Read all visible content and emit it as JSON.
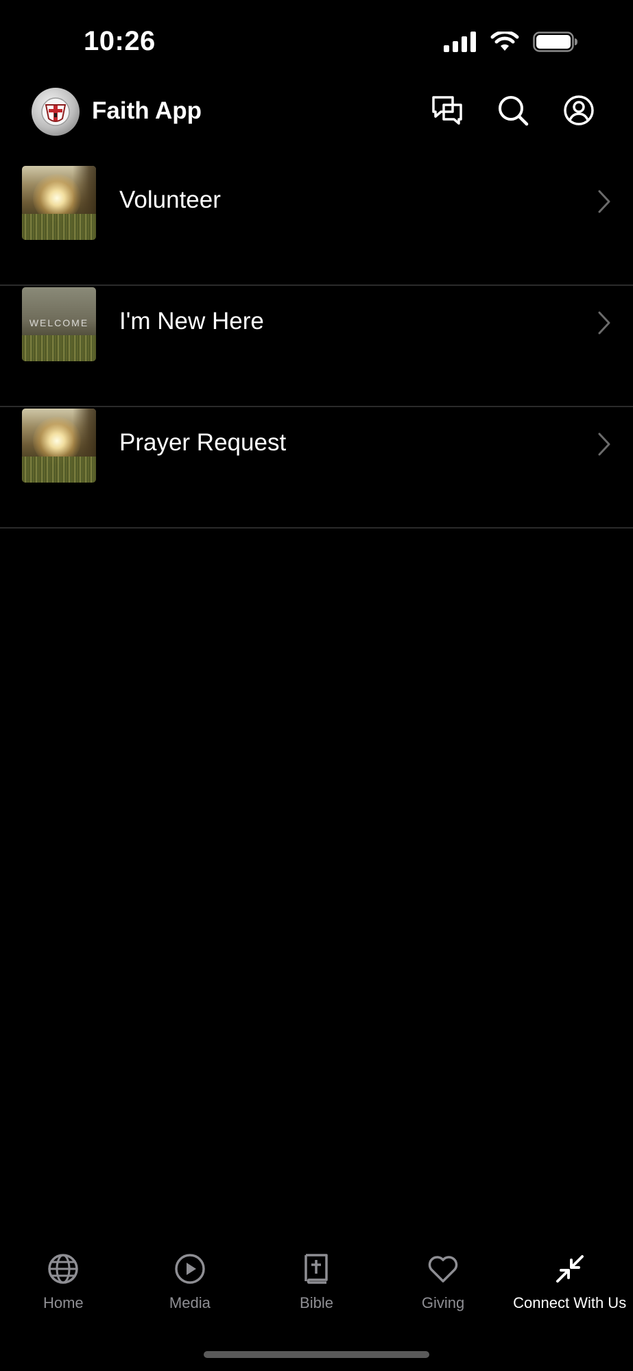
{
  "status_bar": {
    "time": "10:26"
  },
  "header": {
    "title": "Faith App"
  },
  "list": {
    "items": [
      {
        "label": "Volunteer"
      },
      {
        "label": "I'm New Here",
        "thumb_text": "WELCOME"
      },
      {
        "label": "Prayer Request"
      }
    ]
  },
  "tabs": [
    {
      "label": "Home",
      "icon": "globe-icon"
    },
    {
      "label": "Media",
      "icon": "play-icon"
    },
    {
      "label": "Bible",
      "icon": "bible-icon"
    },
    {
      "label": "Giving",
      "icon": "heart-icon"
    },
    {
      "label": "Connect With Us",
      "icon": "connect-icon",
      "active": true
    }
  ],
  "colors": {
    "background": "#000000",
    "text": "#ffffff",
    "inactive_tab": "#8e8e93",
    "divider": "#2b2b2b"
  }
}
